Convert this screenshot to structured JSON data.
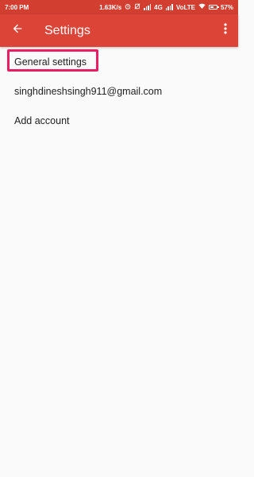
{
  "status_bar": {
    "time": "7:00 PM",
    "speed": "1.63K/s",
    "network_4g": "4G",
    "network_volte": "VoLTE",
    "battery_percent": "57%",
    "battery_level": 0.57
  },
  "app_bar": {
    "title": "Settings",
    "back_icon": "arrow-back-icon",
    "overflow_icon": "more-vert-icon"
  },
  "list": {
    "items": [
      {
        "label": "General settings",
        "highlighted": true
      },
      {
        "label": "singhdineshsingh911@gmail.com"
      },
      {
        "label": "Add account"
      }
    ]
  },
  "colors": {
    "app_bar": "#db4437",
    "status_bar": "#d23f31",
    "highlight": "#e91e63",
    "background": "#fafafa"
  }
}
